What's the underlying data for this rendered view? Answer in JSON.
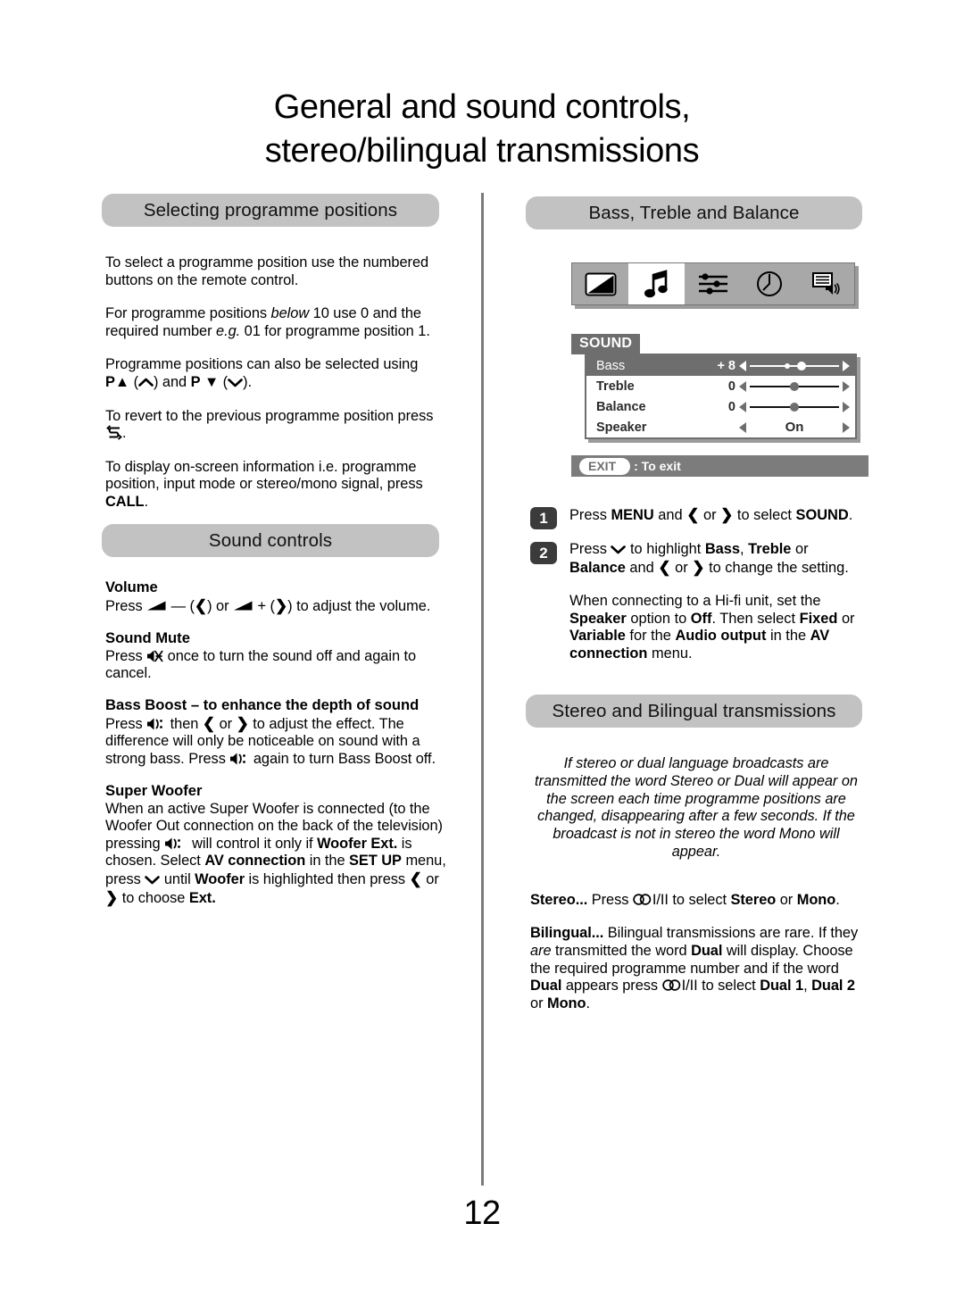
{
  "page": {
    "title_line1": "General and sound controls,",
    "title_line2": "stereo/bilingual transmissions",
    "number": "12"
  },
  "colors": {
    "section_bar": "#c2c2c2",
    "osd_grey": "#6e6e6e",
    "osd_icon_bar": "#a8a8a8",
    "step_badge": "#3b3b3b",
    "divider": "#7b7b7b"
  },
  "left_column": {
    "section1": {
      "heading": "Selecting programme positions",
      "paragraphs": [
        "To select a programme position use the numbered buttons on the remote control.",
        "For programme positions below 10 use 0 and the required number e.g. 01 for programme position 1.",
        "Programme positions can also be selected using P▲ (⌃) and P ▼ (⌄).",
        "To revert to the previous programme position press ↺.",
        "To display on-screen information i.e. programme position, input mode or stereo/mono signal, press CALL."
      ]
    },
    "section2": {
      "heading": "Sound controls",
      "items": [
        {
          "title": "Volume",
          "body": "Press ◿ — (❮) or ◿ + (❯) to adjust the volume."
        },
        {
          "title": "Sound Mute",
          "body": "Press 🔇 once to turn the sound off and again to cancel."
        },
        {
          "title": "Bass Boost – to enhance the depth of sound",
          "body": "Press 🔊 then ❮ or ❯ to adjust the effect. The difference will only be noticeable on sound with a strong bass. Press 🔊 again to turn Bass Boost off."
        },
        {
          "title": "Super Woofer",
          "body": "When an active Super Woofer is connected (to the Woofer Out connection on the back of the television) pressing 🔊 will control it only if Woofer Ext. is chosen. Select AV connection in the SET UP menu, press ⌄ until Woofer is highlighted then press ❮ or ❯ to choose Ext."
        }
      ]
    }
  },
  "right_column": {
    "section1": {
      "heading": "Bass, Treble and Balance"
    },
    "osd": {
      "icon_bar": [
        {
          "name": "picture-contrast-icon",
          "selected": false
        },
        {
          "name": "music-note-icon",
          "selected": true
        },
        {
          "name": "feature-sliders-icon",
          "selected": false
        },
        {
          "name": "clock-timer-icon",
          "selected": false
        },
        {
          "name": "teletext-speaker-icon",
          "selected": false
        }
      ],
      "menu_title": "SOUND",
      "rows": [
        {
          "label": "Bass",
          "value": "+ 8",
          "control": "slider",
          "position": 58,
          "highlighted": true
        },
        {
          "label": "Treble",
          "value": "0",
          "control": "slider",
          "position": 50,
          "highlighted": false
        },
        {
          "label": "Balance",
          "value": "0",
          "control": "slider",
          "position": 50,
          "highlighted": false
        },
        {
          "label": "Speaker",
          "value": "On",
          "control": "option",
          "highlighted": false
        }
      ],
      "exit_button_label": "EXIT",
      "exit_text": ": To exit"
    },
    "steps": [
      {
        "num": "1",
        "text": "Press MENU and ❮ or ❯ to select SOUND."
      },
      {
        "num": "2",
        "text": "Press ⌄ to highlight Bass, Treble or Balance and ❮ or ❯ to change the setting."
      }
    ],
    "note": "When connecting to a Hi-fi unit, set the Speaker option to Off. Then select Fixed or Variable for the Audio output in the AV connection menu.",
    "section2": {
      "heading": "Stereo and Bilingual transmissions",
      "intro": "If stereo or dual language broadcasts are transmitted the word Stereo or Dual will appear on the screen each time programme positions are changed, disappearing after a few seconds. If the broadcast is not in stereo the word Mono will appear.",
      "stereo_label": "Stereo...",
      "stereo_body": "Press ◎ I/II to select Stereo or Mono.",
      "bilingual_label": "Bilingual...",
      "bilingual_body": "Bilingual transmissions are rare. If they are transmitted the word Dual will display. Choose the required programme number and if the word Dual appears press ◎ I/II to select Dual 1, Dual 2 or Mono."
    }
  }
}
